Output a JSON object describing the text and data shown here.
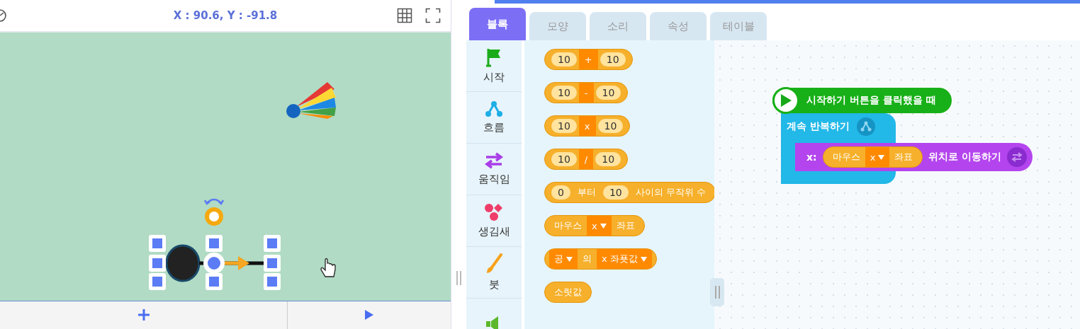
{
  "stage": {
    "coordinates": "X : 90.6, Y : -91.8"
  },
  "tabs": [
    {
      "label": "블록",
      "selected": true
    },
    {
      "label": "모양",
      "selected": false
    },
    {
      "label": "소리",
      "selected": false
    },
    {
      "label": "속성",
      "selected": false
    },
    {
      "label": "테이블",
      "selected": false
    }
  ],
  "categories": [
    {
      "kind": "start",
      "label": "시작"
    },
    {
      "kind": "flow",
      "label": "흐름"
    },
    {
      "kind": "motion",
      "label": "움직임"
    },
    {
      "kind": "looks",
      "label": "생김새"
    },
    {
      "kind": "brush",
      "label": "붓"
    },
    {
      "kind": "sound"
    }
  ],
  "palette": [
    {
      "parts": [
        {
          "kind": "input",
          "text": "10"
        },
        {
          "kind": "op",
          "text": "+"
        },
        {
          "kind": "input",
          "text": "10"
        }
      ]
    },
    {
      "parts": [
        {
          "kind": "input",
          "text": "10"
        },
        {
          "kind": "op",
          "text": "-"
        },
        {
          "kind": "input",
          "text": "10"
        }
      ]
    },
    {
      "parts": [
        {
          "kind": "input",
          "text": "10"
        },
        {
          "kind": "op",
          "text": "x"
        },
        {
          "kind": "input",
          "text": "10"
        }
      ]
    },
    {
      "parts": [
        {
          "kind": "input",
          "text": "10"
        },
        {
          "kind": "op",
          "text": "/"
        },
        {
          "kind": "input",
          "text": "10"
        }
      ]
    },
    {
      "parts": [
        {
          "kind": "input",
          "text": "0"
        },
        {
          "kind": "text",
          "text": "부터"
        },
        {
          "kind": "input",
          "text": "10"
        },
        {
          "kind": "text",
          "text": "사이의 무작위 수"
        }
      ]
    },
    {
      "parts": [
        {
          "kind": "text",
          "text": "마우스"
        },
        {
          "kind": "dropdown",
          "text": "x"
        },
        {
          "kind": "text",
          "text": "좌표"
        }
      ]
    },
    {
      "parts": [
        {
          "kind": "dropdown",
          "text": "공"
        },
        {
          "kind": "text",
          "text": "의"
        },
        {
          "kind": "dropdown",
          "text": "x 좌푯값"
        }
      ]
    },
    {
      "parts": [
        {
          "kind": "text",
          "text": "소릿값"
        }
      ]
    }
  ],
  "script": {
    "start": "시작하기 버튼을 클릭했을 때",
    "loop": "계속 반복하기",
    "move": {
      "prefix": "x:",
      "parts": [
        {
          "kind": "text",
          "text": "마우스"
        },
        {
          "kind": "dropdown",
          "text": "x"
        },
        {
          "kind": "text",
          "text": "좌표"
        }
      ],
      "suffix": "위치로 이동하기"
    }
  }
}
